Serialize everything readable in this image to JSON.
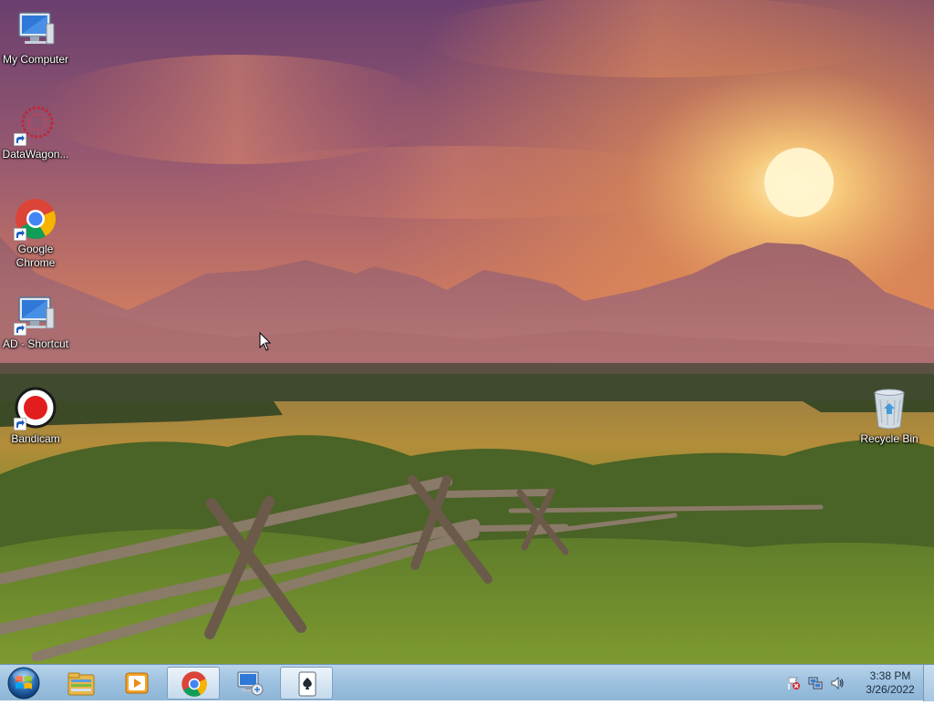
{
  "desktop": {
    "icons": [
      {
        "label": "My Computer",
        "icon": "computer-icon"
      },
      {
        "label": "DataWagon...",
        "icon": "datawagon-icon"
      },
      {
        "label": "Google Chrome",
        "icon": "chrome-icon"
      },
      {
        "label": "AD - Shortcut",
        "icon": "computer-shortcut-icon"
      },
      {
        "label": "Bandicam",
        "icon": "bandicam-icon"
      },
      {
        "label": "Recycle Bin",
        "icon": "recycle-bin-icon"
      }
    ]
  },
  "taskbar": {
    "start_icon": "windows-logo-icon",
    "pinned": [
      {
        "icon": "file-explorer-icon",
        "active": false
      },
      {
        "icon": "media-player-icon",
        "active": false
      },
      {
        "icon": "chrome-icon",
        "active": true
      },
      {
        "icon": "remote-desktop-icon",
        "active": false
      },
      {
        "icon": "solitaire-icon",
        "active": true
      }
    ],
    "tray": {
      "icons": [
        "action-center-flag-icon",
        "network-icon",
        "volume-icon"
      ],
      "time": "3:38 PM",
      "date": "3/26/2022"
    }
  },
  "colors": {
    "taskbar_top": "#b8d4ea",
    "taskbar_bottom": "#8db5d6",
    "sky_purple": "#7d4a75",
    "sun_orange": "#f7a24a"
  }
}
